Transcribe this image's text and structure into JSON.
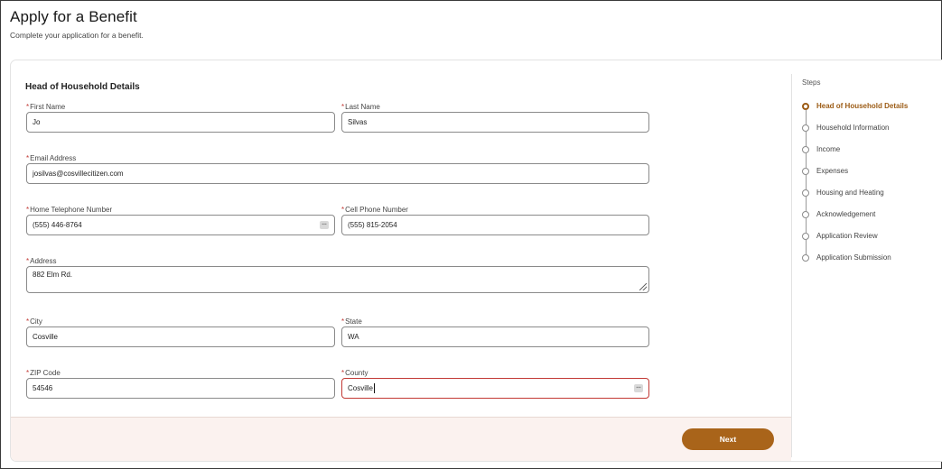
{
  "header": {
    "title": "Apply for a Benefit",
    "subtitle": "Complete your application for a benefit."
  },
  "form": {
    "section_title": "Head of Household Details",
    "required_marker": "*",
    "fields": {
      "first_name": {
        "label": "First Name",
        "value": "Jo"
      },
      "last_name": {
        "label": "Last Name",
        "value": "Silvas"
      },
      "email": {
        "label": "Email Address",
        "value": "josilvas@cosvillecitizen.com"
      },
      "home_phone": {
        "label": "Home Telephone Number",
        "value": "(555) 446-8764"
      },
      "cell_phone": {
        "label": "Cell Phone Number",
        "value": "(555) 815-2054"
      },
      "address": {
        "label": "Address",
        "value": "882 Elm Rd."
      },
      "city": {
        "label": "City",
        "value": "Cosville"
      },
      "state": {
        "label": "State",
        "value": "WA"
      },
      "zip": {
        "label": "ZIP Code",
        "value": "54546"
      },
      "county": {
        "label": "County",
        "value": "Cosville"
      }
    },
    "next_label": "Next"
  },
  "steps": {
    "title": "Steps",
    "items": [
      {
        "label": "Head of Household Details",
        "current": true
      },
      {
        "label": "Household Information",
        "current": false
      },
      {
        "label": "Income",
        "current": false
      },
      {
        "label": "Expenses",
        "current": false
      },
      {
        "label": "Housing and Heating",
        "current": false
      },
      {
        "label": "Acknowledgement",
        "current": false
      },
      {
        "label": "Application Review",
        "current": false
      },
      {
        "label": "Application Submission",
        "current": false
      }
    ]
  },
  "colors": {
    "accent": "#a9641a",
    "required": "#c23934",
    "footer_bg": "#fbf2ef"
  }
}
